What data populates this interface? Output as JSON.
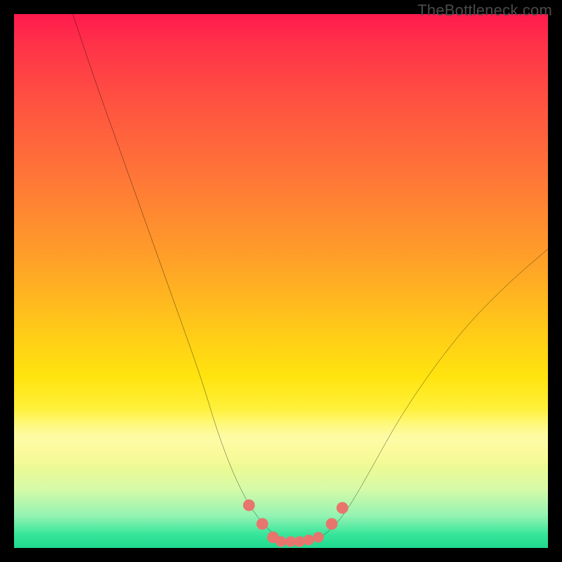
{
  "watermark": "TheBottleneck.com",
  "chart_data": {
    "type": "line",
    "title": "",
    "xlabel": "",
    "ylabel": "",
    "xlim": [
      0,
      100
    ],
    "ylim": [
      0,
      100
    ],
    "grid": false,
    "background_gradient": {
      "orientation": "vertical",
      "stops": [
        {
          "pct": 0,
          "color": "#ff1a4d"
        },
        {
          "pct": 18,
          "color": "#ff5640"
        },
        {
          "pct": 46,
          "color": "#ffa028"
        },
        {
          "pct": 68,
          "color": "#ffe40e"
        },
        {
          "pct": 89,
          "color": "#d6faa8"
        },
        {
          "pct": 100,
          "color": "#1fd98e"
        }
      ]
    },
    "series": [
      {
        "name": "bottleneck-curve",
        "color": "#000000",
        "x": [
          11,
          15,
          20,
          25,
          30,
          35,
          38,
          41,
          44,
          47,
          49.5,
          52,
          55,
          57.5,
          60,
          63,
          67,
          72,
          78,
          85,
          93,
          100
        ],
        "y": [
          100,
          88,
          74,
          60,
          46,
          32,
          22,
          14,
          8,
          4,
          2,
          1.2,
          1.2,
          2,
          4,
          8,
          15,
          24,
          33,
          42,
          50,
          56
        ]
      }
    ],
    "markers": {
      "name": "bottom-dots",
      "color": "#e8746e",
      "points": [
        {
          "x": 44.0,
          "y": 8.0,
          "r": 1.1
        },
        {
          "x": 46.5,
          "y": 4.5,
          "r": 1.1
        },
        {
          "x": 48.5,
          "y": 2.0,
          "r": 1.1
        },
        {
          "x": 50.0,
          "y": 1.2,
          "r": 1.0
        },
        {
          "x": 51.8,
          "y": 1.2,
          "r": 1.0
        },
        {
          "x": 53.5,
          "y": 1.2,
          "r": 1.0
        },
        {
          "x": 55.2,
          "y": 1.5,
          "r": 1.0
        },
        {
          "x": 57.0,
          "y": 2.0,
          "r": 1.0
        },
        {
          "x": 59.5,
          "y": 4.5,
          "r": 1.1
        },
        {
          "x": 61.5,
          "y": 7.5,
          "r": 1.1
        }
      ]
    }
  }
}
